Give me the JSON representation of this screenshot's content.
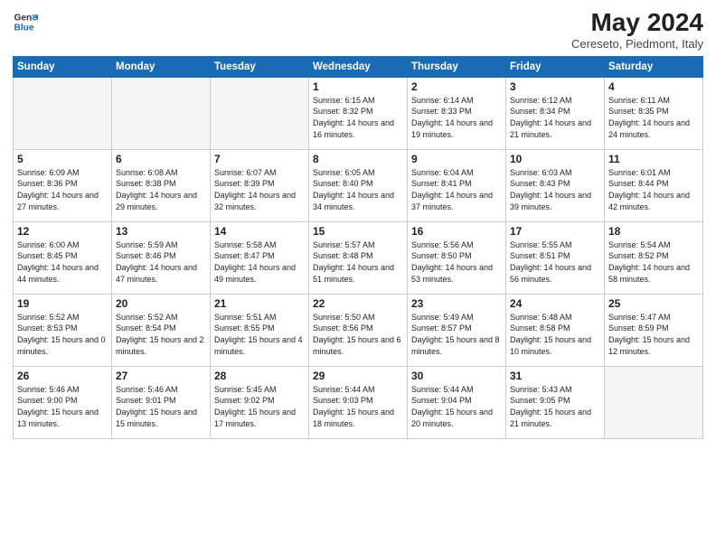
{
  "logo": {
    "line1": "General",
    "line2": "Blue"
  },
  "title": "May 2024",
  "subtitle": "Cereseto, Piedmont, Italy",
  "headers": [
    "Sunday",
    "Monday",
    "Tuesday",
    "Wednesday",
    "Thursday",
    "Friday",
    "Saturday"
  ],
  "weeks": [
    [
      {
        "day": "",
        "info": ""
      },
      {
        "day": "",
        "info": ""
      },
      {
        "day": "",
        "info": ""
      },
      {
        "day": "1",
        "info": "Sunrise: 6:15 AM\nSunset: 8:32 PM\nDaylight: 14 hours and 16 minutes."
      },
      {
        "day": "2",
        "info": "Sunrise: 6:14 AM\nSunset: 8:33 PM\nDaylight: 14 hours and 19 minutes."
      },
      {
        "day": "3",
        "info": "Sunrise: 6:12 AM\nSunset: 8:34 PM\nDaylight: 14 hours and 21 minutes."
      },
      {
        "day": "4",
        "info": "Sunrise: 6:11 AM\nSunset: 8:35 PM\nDaylight: 14 hours and 24 minutes."
      }
    ],
    [
      {
        "day": "5",
        "info": "Sunrise: 6:09 AM\nSunset: 8:36 PM\nDaylight: 14 hours and 27 minutes."
      },
      {
        "day": "6",
        "info": "Sunrise: 6:08 AM\nSunset: 8:38 PM\nDaylight: 14 hours and 29 minutes."
      },
      {
        "day": "7",
        "info": "Sunrise: 6:07 AM\nSunset: 8:39 PM\nDaylight: 14 hours and 32 minutes."
      },
      {
        "day": "8",
        "info": "Sunrise: 6:05 AM\nSunset: 8:40 PM\nDaylight: 14 hours and 34 minutes."
      },
      {
        "day": "9",
        "info": "Sunrise: 6:04 AM\nSunset: 8:41 PM\nDaylight: 14 hours and 37 minutes."
      },
      {
        "day": "10",
        "info": "Sunrise: 6:03 AM\nSunset: 8:43 PM\nDaylight: 14 hours and 39 minutes."
      },
      {
        "day": "11",
        "info": "Sunrise: 6:01 AM\nSunset: 8:44 PM\nDaylight: 14 hours and 42 minutes."
      }
    ],
    [
      {
        "day": "12",
        "info": "Sunrise: 6:00 AM\nSunset: 8:45 PM\nDaylight: 14 hours and 44 minutes."
      },
      {
        "day": "13",
        "info": "Sunrise: 5:59 AM\nSunset: 8:46 PM\nDaylight: 14 hours and 47 minutes."
      },
      {
        "day": "14",
        "info": "Sunrise: 5:58 AM\nSunset: 8:47 PM\nDaylight: 14 hours and 49 minutes."
      },
      {
        "day": "15",
        "info": "Sunrise: 5:57 AM\nSunset: 8:48 PM\nDaylight: 14 hours and 51 minutes."
      },
      {
        "day": "16",
        "info": "Sunrise: 5:56 AM\nSunset: 8:50 PM\nDaylight: 14 hours and 53 minutes."
      },
      {
        "day": "17",
        "info": "Sunrise: 5:55 AM\nSunset: 8:51 PM\nDaylight: 14 hours and 56 minutes."
      },
      {
        "day": "18",
        "info": "Sunrise: 5:54 AM\nSunset: 8:52 PM\nDaylight: 14 hours and 58 minutes."
      }
    ],
    [
      {
        "day": "19",
        "info": "Sunrise: 5:52 AM\nSunset: 8:53 PM\nDaylight: 15 hours and 0 minutes."
      },
      {
        "day": "20",
        "info": "Sunrise: 5:52 AM\nSunset: 8:54 PM\nDaylight: 15 hours and 2 minutes."
      },
      {
        "day": "21",
        "info": "Sunrise: 5:51 AM\nSunset: 8:55 PM\nDaylight: 15 hours and 4 minutes."
      },
      {
        "day": "22",
        "info": "Sunrise: 5:50 AM\nSunset: 8:56 PM\nDaylight: 15 hours and 6 minutes."
      },
      {
        "day": "23",
        "info": "Sunrise: 5:49 AM\nSunset: 8:57 PM\nDaylight: 15 hours and 8 minutes."
      },
      {
        "day": "24",
        "info": "Sunrise: 5:48 AM\nSunset: 8:58 PM\nDaylight: 15 hours and 10 minutes."
      },
      {
        "day": "25",
        "info": "Sunrise: 5:47 AM\nSunset: 8:59 PM\nDaylight: 15 hours and 12 minutes."
      }
    ],
    [
      {
        "day": "26",
        "info": "Sunrise: 5:46 AM\nSunset: 9:00 PM\nDaylight: 15 hours and 13 minutes."
      },
      {
        "day": "27",
        "info": "Sunrise: 5:46 AM\nSunset: 9:01 PM\nDaylight: 15 hours and 15 minutes."
      },
      {
        "day": "28",
        "info": "Sunrise: 5:45 AM\nSunset: 9:02 PM\nDaylight: 15 hours and 17 minutes."
      },
      {
        "day": "29",
        "info": "Sunrise: 5:44 AM\nSunset: 9:03 PM\nDaylight: 15 hours and 18 minutes."
      },
      {
        "day": "30",
        "info": "Sunrise: 5:44 AM\nSunset: 9:04 PM\nDaylight: 15 hours and 20 minutes."
      },
      {
        "day": "31",
        "info": "Sunrise: 5:43 AM\nSunset: 9:05 PM\nDaylight: 15 hours and 21 minutes."
      },
      {
        "day": "",
        "info": ""
      }
    ]
  ]
}
